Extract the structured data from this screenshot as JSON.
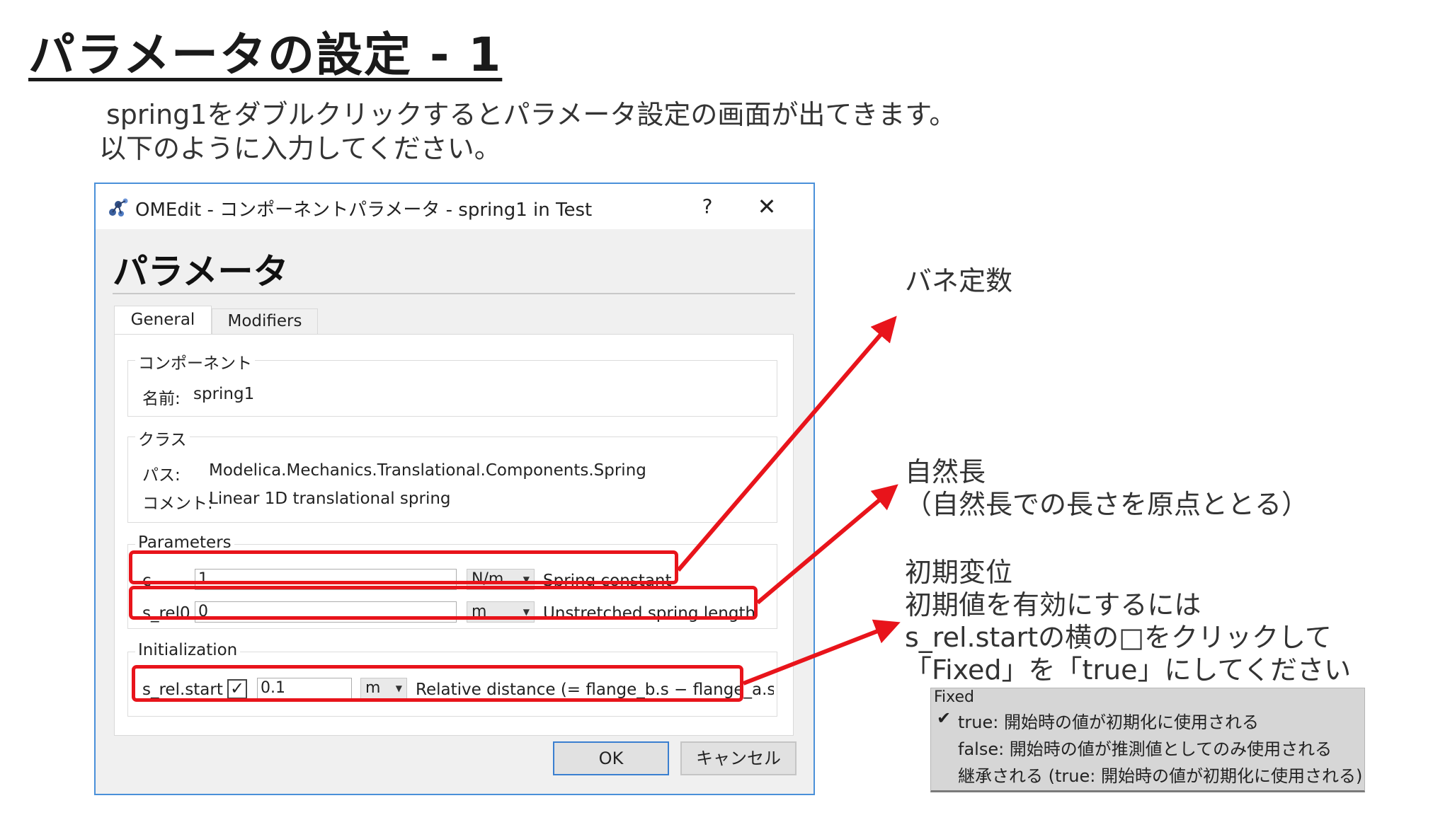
{
  "slide": {
    "title": "パラメータの設定 - 1",
    "intro_line1": "spring1をダブルクリックするとパラメータ設定の画面が出てきます。",
    "intro_line2": "以下のように入力してください。"
  },
  "dialog": {
    "window_title": "OMEdit - コンポーネントパラメータ - spring1 in Test",
    "help_label": "?",
    "close_label": "✕",
    "heading": "パラメータ",
    "tabs": [
      {
        "label": "General"
      },
      {
        "label": "Modifiers"
      }
    ],
    "component": {
      "group_title": "コンポーネント",
      "name_label": "名前:",
      "name_value": "spring1"
    },
    "class": {
      "group_title": "クラス",
      "path_label": "パス:",
      "path_value": "Modelica.Mechanics.Translational.Components.Spring",
      "comment_label": "コメント:",
      "comment_value": "Linear 1D translational spring"
    },
    "parameters": {
      "group_title": "Parameters",
      "rows": [
        {
          "name": "c",
          "value": "1",
          "unit": "N/m",
          "description": "Spring constant"
        },
        {
          "name": "s_rel0",
          "value": "0",
          "unit": "m",
          "description": "Unstretched spring length"
        }
      ]
    },
    "initialization": {
      "group_title": "Initialization",
      "name": "s_rel.start",
      "check_mark": "✓",
      "value": "0.1",
      "unit": "m",
      "description": "Relative distance (= flange_b.s − flange_a.s"
    },
    "ok_label": "OK",
    "cancel_label": "キャンセル"
  },
  "annotations": {
    "spring_constant": "バネ定数",
    "natural_length_1": "自然長",
    "natural_length_2": "（自然長での長さを原点ととる）",
    "init_1": "初期変位",
    "init_2": "初期値を有効にするには",
    "init_3": "s_rel.startの横の□をクリックして",
    "init_4": "「Fixed」を「true」にしてください"
  },
  "fixed_popup": {
    "title": "Fixed",
    "check_mark": "✔",
    "options": [
      "true: 開始時の値が初期化に使用される",
      "false: 開始時の値が推測値としてのみ使用される",
      "継承される (true: 開始時の値が初期化に使用される)"
    ]
  },
  "colors": {
    "highlight": "#e8141b",
    "dialog_border": "#4a90d9",
    "dialog_background": "#f0f0f0"
  }
}
